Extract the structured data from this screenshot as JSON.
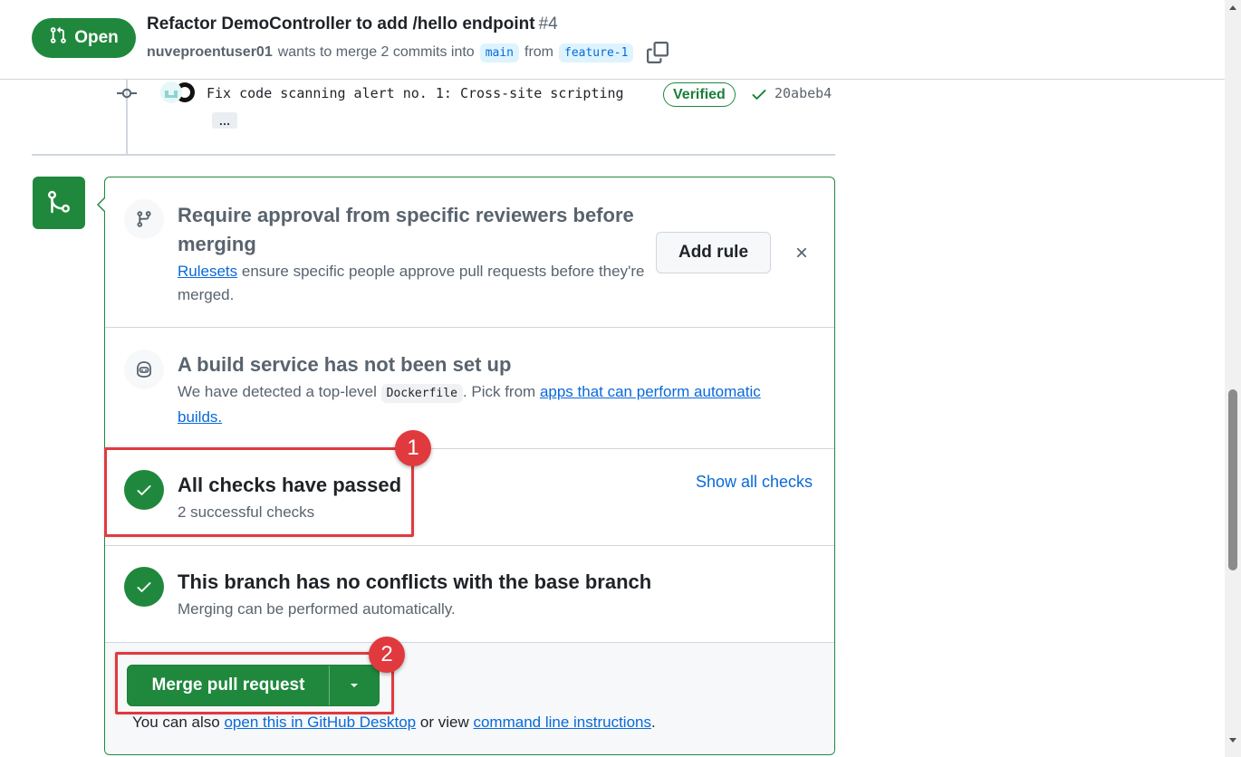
{
  "header": {
    "state_label": "Open",
    "title": "Refactor DemoController to add /hello endpoint",
    "number": "#4",
    "author": "nuveproentuser01",
    "merge_text": "wants to merge 2 commits into",
    "base_branch": "main",
    "from_text": "from",
    "head_branch": "feature-1"
  },
  "commit": {
    "message": "Fix code scanning alert no. 1: Cross-site scripting",
    "verified_label": "Verified",
    "sha": "20abeb4",
    "ellipsis": "…"
  },
  "merge_box": {
    "rulesets": {
      "title": "Require approval from specific reviewers before merging",
      "link_text": "Rulesets",
      "desc_rest": "ensure specific people approve pull requests before they're merged.",
      "add_rule_label": "Add rule"
    },
    "build": {
      "title": "A build service has not been set up",
      "desc_prefix": "We have detected a top-level",
      "code": "Dockerfile",
      "desc_mid": ". Pick from",
      "link_text": "apps that can perform automatic builds."
    },
    "checks": {
      "title": "All checks have passed",
      "subtitle": "2 successful checks",
      "show_all_label": "Show all checks"
    },
    "conflicts": {
      "title": "This branch has no conflicts with the base branch",
      "subtitle": "Merging can be performed automatically."
    },
    "footer": {
      "merge_label": "Merge pull request",
      "text_prefix": "You can also",
      "desktop_link": "open this in GitHub Desktop",
      "text_mid": "or view",
      "cli_link": "command line instructions",
      "text_suffix": "."
    }
  },
  "annotations": {
    "step1": "1",
    "step2": "2",
    "color": "#e03a3e"
  },
  "colors": {
    "success": "#1f883d",
    "link": "#0969da",
    "muted": "#59636e"
  }
}
